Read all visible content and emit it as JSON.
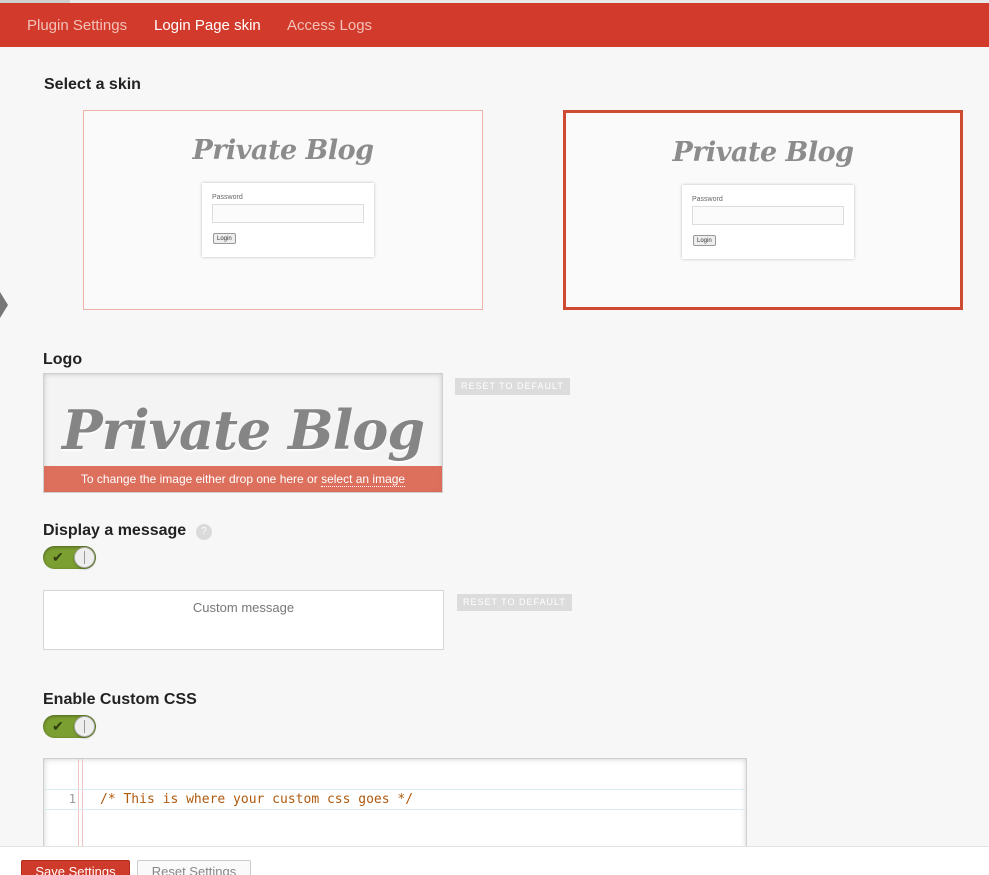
{
  "nav": {
    "tabs": [
      {
        "label": "Plugin Settings",
        "active": false
      },
      {
        "label": "Login Page skin",
        "active": true
      },
      {
        "label": "Access Logs",
        "active": false
      }
    ]
  },
  "skins": {
    "title": "Select a skin",
    "items": [
      {
        "brand": "Private Blog",
        "password_label": "Password",
        "login_button": "Login",
        "selected": false
      },
      {
        "brand": "Private Blog",
        "password_label": "Password",
        "login_button": "Login",
        "selected": true
      }
    ]
  },
  "logo": {
    "title": "Logo",
    "image_text": "Private Blog",
    "overlay_prefix": "To change the image either drop one here or ",
    "overlay_link": "select an image",
    "reset_label": "RESET TO DEFAULT"
  },
  "message": {
    "title": "Display a message",
    "help_icon": "?",
    "enabled": true,
    "placeholder": "Custom message",
    "reset_label": "RESET TO DEFAULT"
  },
  "custom_css": {
    "title": "Enable Custom CSS",
    "enabled": true,
    "line_number": "1",
    "code": "/* This is where your custom css goes */"
  },
  "footer": {
    "save_label": "Save Settings",
    "reset_label": "Reset Settings"
  },
  "colors": {
    "accent": "#d23b2c",
    "toggle_on": "#7c9f31"
  }
}
